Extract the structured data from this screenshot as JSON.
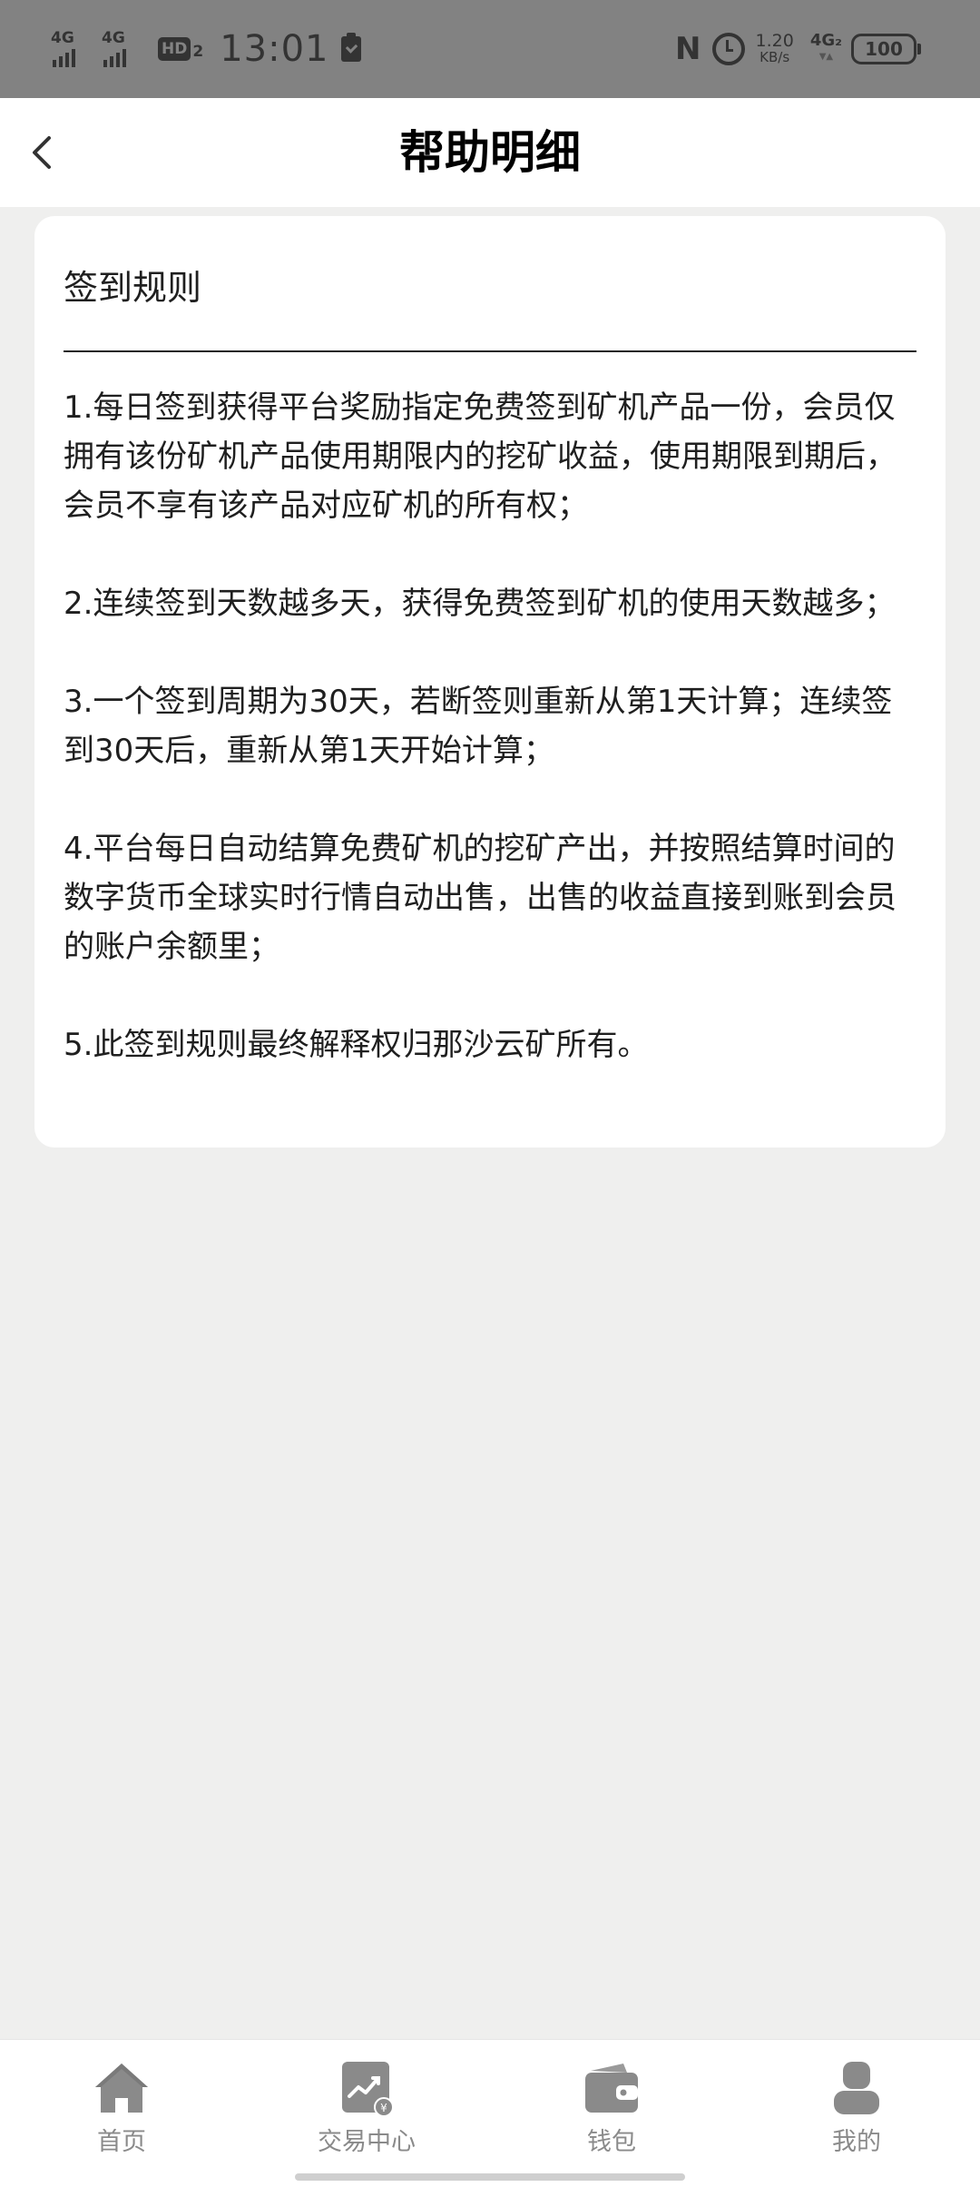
{
  "status_bar": {
    "signal1_label": "4G",
    "signal2_label": "4G",
    "hd_label": "HD",
    "hd_sub": "2",
    "time": "13:01",
    "nfc_label": "N",
    "net_speed_value": "1.20",
    "net_speed_unit": "KB/s",
    "net_type": "4G₂",
    "battery": "100"
  },
  "header": {
    "title": "帮助明细"
  },
  "card": {
    "title": "签到规则",
    "rules": [
      "1.每日签到获得平台奖励指定免费签到矿机产品一份，会员仅拥有该份矿机产品使用期限内的挖矿收益，使用期限到期后，会员不享有该产品对应矿机的所有权；",
      "2.连续签到天数越多天，获得免费签到矿机的使用天数越多；",
      "3.一个签到周期为30天，若断签则重新从第1天计算；连续签到30天后，重新从第1天开始计算；",
      "4.平台每日自动结算免费矿机的挖矿产出，并按照结算时间的数字货币全球实时行情自动出售，出售的收益直接到账到会员的账户余额里；",
      "5.此签到规则最终解释权归那沙云矿所有。"
    ]
  },
  "bottom_nav": {
    "items": [
      {
        "label": "首页",
        "icon": "home-icon"
      },
      {
        "label": "交易中心",
        "icon": "trade-chart-icon"
      },
      {
        "label": "钱包",
        "icon": "wallet-icon"
      },
      {
        "label": "我的",
        "icon": "profile-icon"
      }
    ]
  },
  "colors": {
    "status_bar_bg": "#828282",
    "page_bg": "#efefee",
    "card_bg": "#ffffff",
    "nav_icon": "#8a8a8a"
  }
}
